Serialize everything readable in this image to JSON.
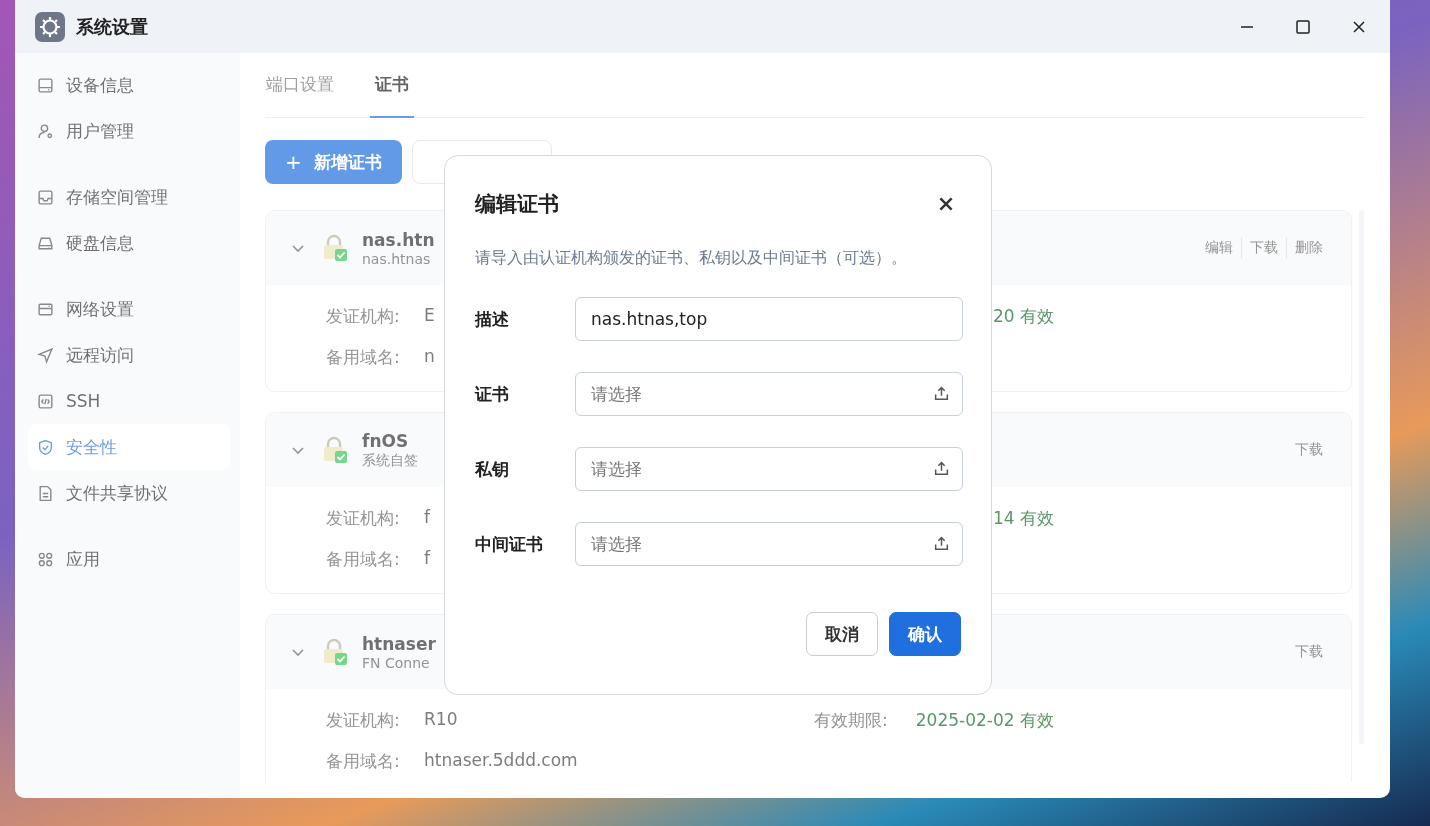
{
  "window": {
    "title": "系统设置"
  },
  "sidebar": {
    "groups": [
      {
        "items": [
          {
            "kind": "device",
            "label": "设备信息",
            "selected": false
          },
          {
            "kind": "users",
            "label": "用户管理",
            "selected": false
          }
        ]
      },
      {
        "items": [
          {
            "kind": "storage",
            "label": "存储空间管理",
            "selected": false
          },
          {
            "kind": "disk",
            "label": "硬盘信息",
            "selected": false
          }
        ]
      },
      {
        "items": [
          {
            "kind": "network",
            "label": "网络设置",
            "selected": false
          },
          {
            "kind": "remote",
            "label": "远程访问",
            "selected": false
          },
          {
            "kind": "ssh",
            "label": "SSH",
            "selected": false
          },
          {
            "kind": "security",
            "label": "安全性",
            "selected": true
          },
          {
            "kind": "share",
            "label": "文件共享协议",
            "selected": false
          }
        ]
      },
      {
        "items": [
          {
            "kind": "apps",
            "label": "应用",
            "selected": false
          }
        ]
      }
    ]
  },
  "tabs": [
    {
      "label": "端口设置",
      "selected": false
    },
    {
      "label": "证书",
      "selected": true
    }
  ],
  "toolbar": {
    "add_button": "新增证书",
    "add_icon": "+"
  },
  "certificates": [
    {
      "name": "nas.htn",
      "subtitle": "nas.htnas",
      "expanded": true,
      "actions": [
        "编辑",
        "下载",
        "删除"
      ],
      "issuer_label": "发证机构:",
      "issuer": "E",
      "validity": "20 有效",
      "alt_label": "备用域名:",
      "alt": "n"
    },
    {
      "name": "fnOS",
      "subtitle": "系统自签",
      "expanded": true,
      "actions": [
        "下载"
      ],
      "issuer_label": "发证机构:",
      "issuer": "f",
      "validity": "14 有效",
      "alt_label": "备用域名:",
      "alt": "f"
    },
    {
      "name": "htnaser",
      "subtitle": "FN Conne",
      "expanded": true,
      "actions": [
        "下载"
      ],
      "issuer_label": "发证机构:",
      "issuer": "R10",
      "validity_label": "有效期限:",
      "validity": "2025-02-02 有效",
      "alt_label": "备用域名:",
      "alt": "htnaser.5ddd.com"
    }
  ],
  "dialog": {
    "title": "编辑证书",
    "description": "请导入由认证机构颁发的证书、私钥以及中间证书（可选）。",
    "fields": [
      {
        "kind": "text",
        "label": "描述",
        "value": "nas.htnas,top"
      },
      {
        "kind": "file",
        "label": "证书",
        "placeholder": "请选择"
      },
      {
        "kind": "file",
        "label": "私钥",
        "placeholder": "请选择"
      },
      {
        "kind": "file",
        "label": "中间证书",
        "placeholder": "请选择"
      }
    ],
    "buttons": [
      {
        "kind": "secondary",
        "label": "取消"
      },
      {
        "kind": "primary",
        "label": "确认"
      }
    ]
  }
}
